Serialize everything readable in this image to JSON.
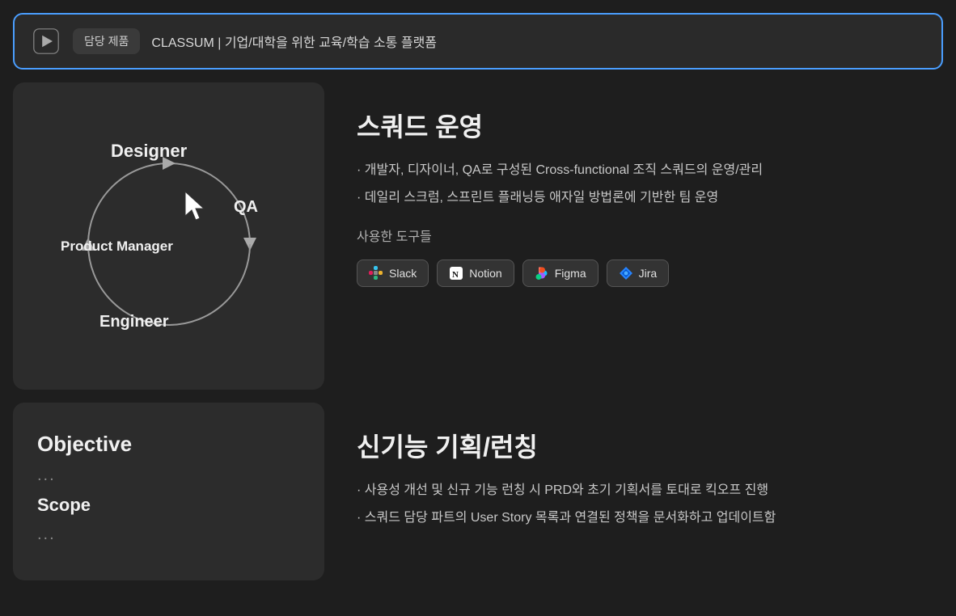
{
  "header": {
    "play_icon": "▶",
    "tag_label": "담당 제품",
    "title": "CLASSUM | 기업/대학을 위한 교육/학습 소통 플랫폼"
  },
  "section1": {
    "diagram": {
      "designer_label": "Designer",
      "qa_label": "QA",
      "pm_label": "Product Manager",
      "engineer_label": "Engineer"
    },
    "title": "스쿼드 운영",
    "bullets": [
      "개발자, 디자이너, QA로 구성된 Cross-functional 조직 스쿼드의 운영/관리",
      "데일리 스크럼, 스프린트 플래닝등 애자일 방법론에 기반한 팀 운영"
    ],
    "tools_label": "사용한 도구들",
    "tools": [
      {
        "name": "Slack",
        "icon_type": "slack"
      },
      {
        "name": "Notion",
        "icon_type": "notion"
      },
      {
        "name": "Figma",
        "icon_type": "figma"
      },
      {
        "name": "Jira",
        "icon_type": "jira"
      }
    ]
  },
  "section2": {
    "card": {
      "objective_label": "Objective",
      "objective_dots": "...",
      "scope_label": "Scope",
      "scope_dots": "..."
    },
    "title": "신기능 기획/런칭",
    "bullets": [
      "사용성 개선 및 신규 기능 런칭 시 PRD와 초기 기획서를 토대로 킥오프 진행",
      "스쿼드 담당 파트의 User Story 목록과 연결된 정책을 문서화하고 업데이트함"
    ]
  }
}
